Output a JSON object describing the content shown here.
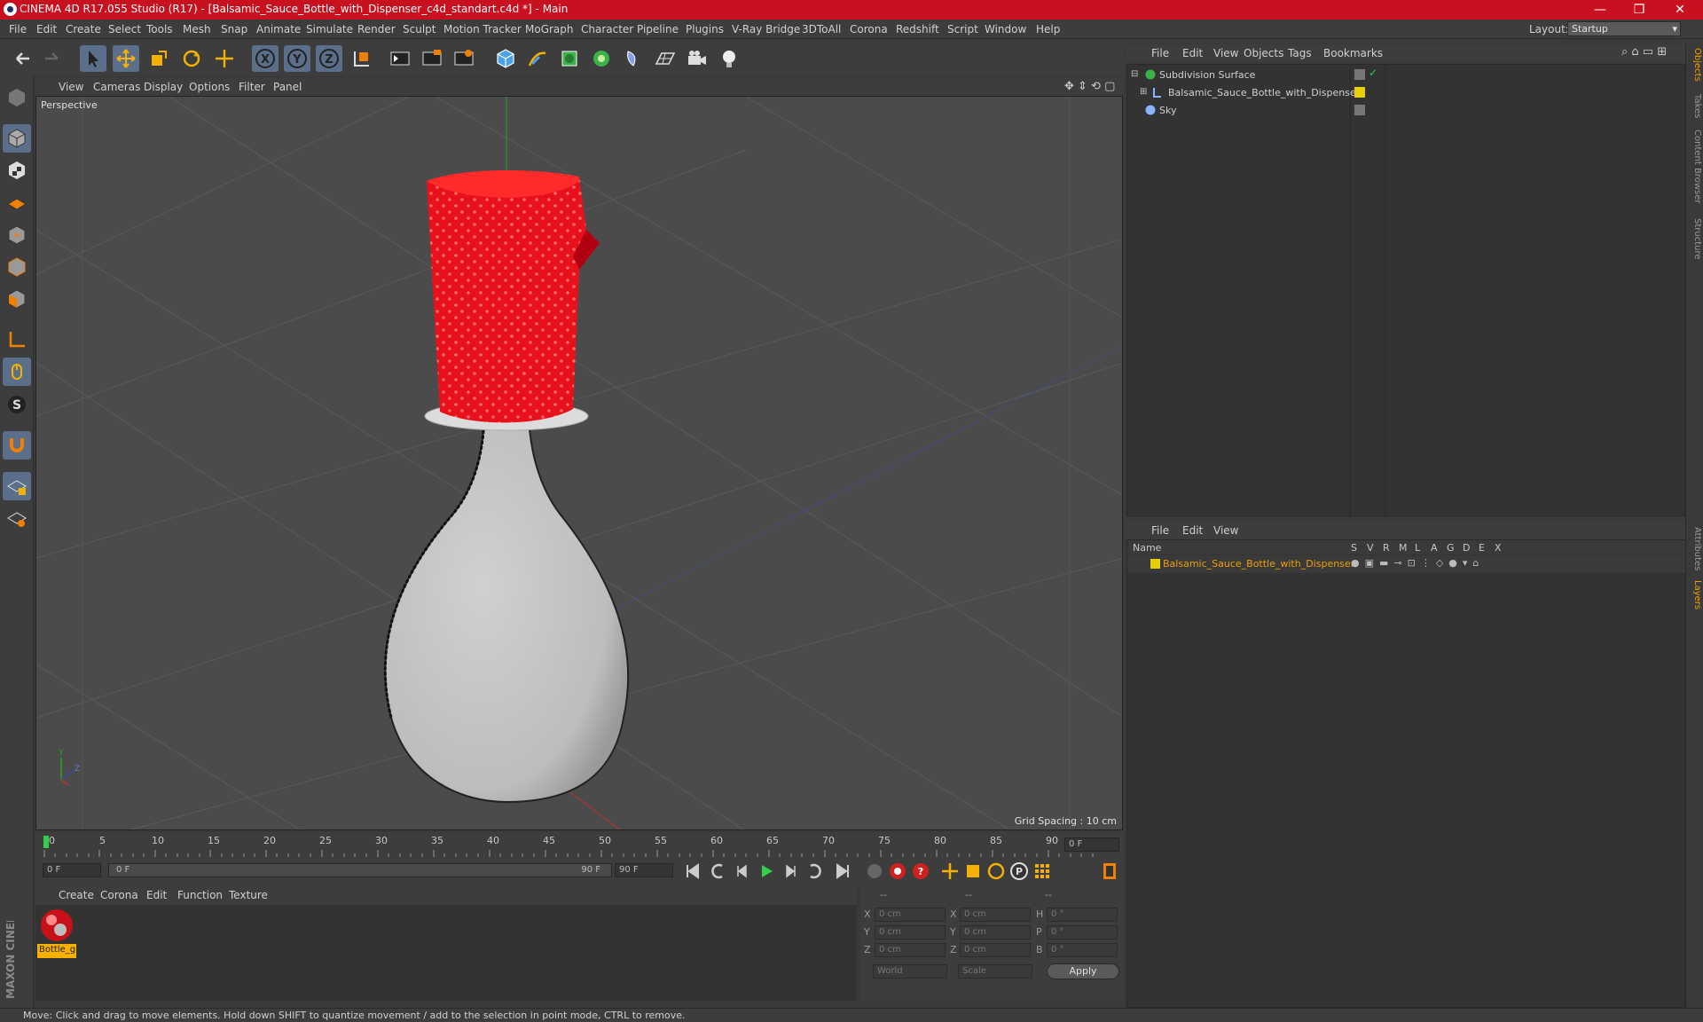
{
  "window": {
    "title": "CINEMA 4D R17.055 Studio (R17) - [Balsamic_Sauce_Bottle_with_Dispenser_c4d_standart.c4d *] - Main",
    "minimize": "—",
    "restore": "❐",
    "close": "✕"
  },
  "menubar": {
    "items": [
      "File",
      "Edit",
      "Create",
      "Select",
      "Tools",
      "Mesh",
      "Snap",
      "Animate",
      "Simulate",
      "Render",
      "Sculpt",
      "Motion Tracker",
      "MoGraph",
      "Character",
      "Pipeline",
      "Plugins",
      "V-Ray Bridge",
      "3DToAll",
      "Corona",
      "Redshift",
      "Script",
      "Window",
      "Help"
    ],
    "layout_label": "Layout:",
    "layout_value": "Startup"
  },
  "viewport": {
    "menu": [
      "View",
      "Cameras",
      "Display",
      "Options",
      "Filter",
      "Panel"
    ],
    "camera_label": "Perspective",
    "grid_spacing": "Grid Spacing : 10 cm"
  },
  "timeline": {
    "ticks": [
      "0",
      "5",
      "10",
      "15",
      "20",
      "25",
      "30",
      "35",
      "40",
      "45",
      "50",
      "55",
      "60",
      "65",
      "70",
      "75",
      "80",
      "85",
      "90"
    ],
    "current_frame": "0 F",
    "start_field": "0 F",
    "range_start": "0 F",
    "range_end": "90 F",
    "end_field": "90 F"
  },
  "material_manager": {
    "menu": [
      "Create",
      "Corona",
      "Edit",
      "Function",
      "Texture"
    ],
    "materials": [
      {
        "name": "Bottle_g"
      }
    ]
  },
  "coordinates": {
    "header": [
      "--",
      "--",
      "--"
    ],
    "rows": [
      {
        "a": "X",
        "av": "0 cm",
        "b": "X",
        "bv": "0 cm",
        "c": "H",
        "cv": "0 °"
      },
      {
        "a": "Y",
        "av": "0 cm",
        "b": "Y",
        "bv": "0 cm",
        "c": "P",
        "cv": "0 °"
      },
      {
        "a": "Z",
        "av": "0 cm",
        "b": "Z",
        "bv": "0 cm",
        "c": "B",
        "cv": "0 °"
      }
    ],
    "mode1": "World",
    "mode2": "Scale",
    "apply": "Apply"
  },
  "object_manager": {
    "menu": [
      "File",
      "Edit",
      "View",
      "Objects",
      "Tags",
      "Bookmarks"
    ],
    "objects": [
      {
        "name": "Subdivision Surface"
      },
      {
        "name": "Balsamic_Sauce_Bottle_with_Dispenser"
      },
      {
        "name": "Sky"
      }
    ]
  },
  "layer_manager": {
    "menu": [
      "File",
      "Edit",
      "View"
    ],
    "columns": [
      "Name",
      "S",
      "V",
      "R",
      "M",
      "L",
      "A",
      "G",
      "D",
      "E",
      "X"
    ],
    "layers": [
      {
        "name": "Balsamic_Sauce_Bottle_with_Dispenser"
      }
    ]
  },
  "right_tabs": [
    "Objects",
    "Takes",
    "Content Browser",
    "Structure",
    "Attributes",
    "Layers"
  ],
  "status": "Move: Click and drag to move elements. Hold down SHIFT to quantize movement / add to the selection in point mode, CTRL to remove.",
  "branding": "MAXON CINEMA 4D",
  "colors": {
    "titlebar": "#c8101f",
    "cap": "#e8101a",
    "bottle": "#c4c4c4",
    "layer_name": "#f0a000",
    "layer_swatch": "#e8d000"
  }
}
